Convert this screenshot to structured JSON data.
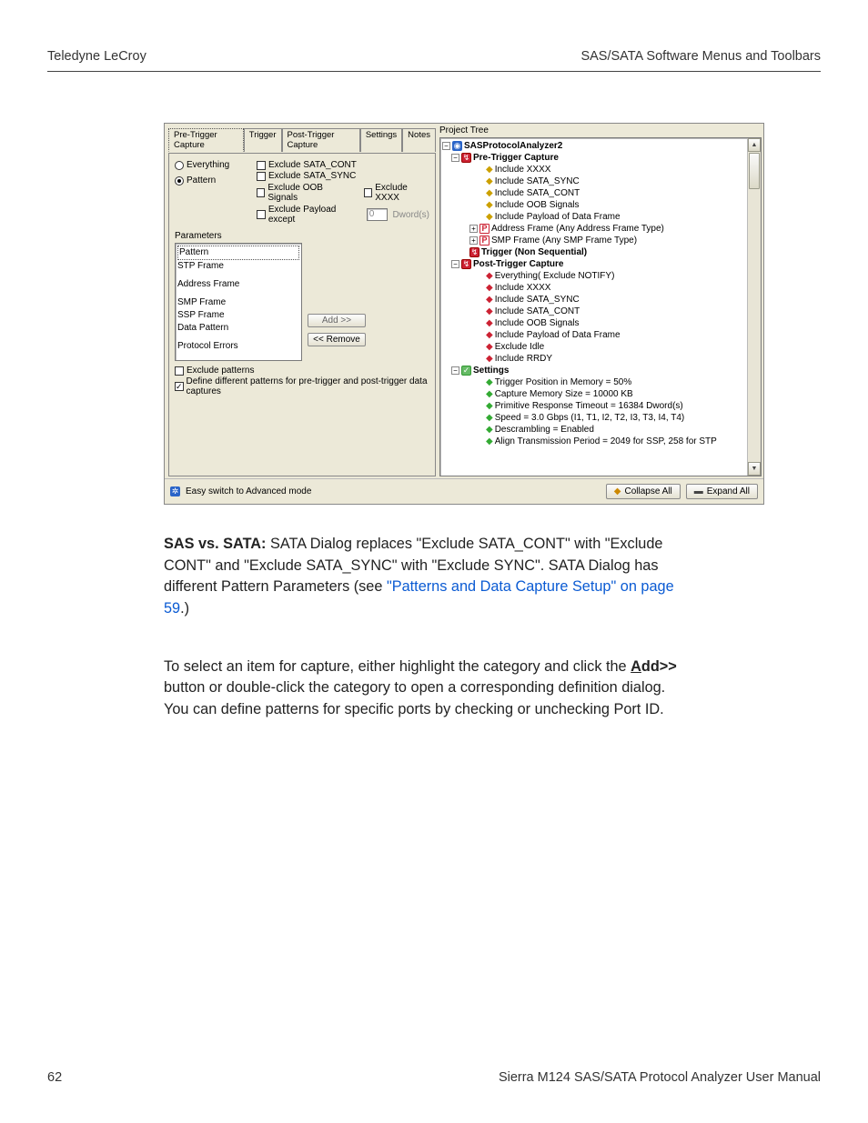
{
  "header": {
    "left": "Teledyne LeCroy",
    "right": "SAS/SATA Software Menus and Toolbars"
  },
  "footer": {
    "page": "62",
    "manual": "Sierra M124 SAS/SATA Protocol Analyzer User Manual"
  },
  "screenshot": {
    "tabs": [
      "Pre-Trigger Capture",
      "Trigger",
      "Post-Trigger Capture",
      "Settings",
      "Notes"
    ],
    "radios": {
      "everything": "Everything",
      "pattern": "Pattern"
    },
    "checks": {
      "excl_sata_cont": "Exclude SATA_CONT",
      "excl_sata_sync": "Exclude SATA_SYNC",
      "excl_oob": "Exclude OOB Signals",
      "excl_xxxx": "Exclude XXXX",
      "excl_payload": "Exclude Payload except",
      "excl_payload_val": "0",
      "excl_payload_dword": "Dword(s)"
    },
    "parameters_label": "Parameters",
    "param_items": [
      "Pattern",
      "STP Frame",
      "Address Frame",
      "SMP Frame",
      "SSP Frame",
      "Data Pattern",
      "Protocol Errors"
    ],
    "add_btn": "Add >>",
    "remove_btn": "<< Remove",
    "exclude_patterns": "Exclude patterns",
    "define_diff": "Define different patterns for pre-trigger and post-trigger data captures",
    "easy_switch": "Easy switch to Advanced mode",
    "project_tree_label": "Project Tree",
    "tree": {
      "root": "SASProtocolAnalyzer2",
      "pre": "Pre-Trigger Capture",
      "pre_items": [
        "Include XXXX",
        "Include SATA_SYNC",
        "Include SATA_CONT",
        "Include OOB Signals",
        "Include Payload of Data Frame"
      ],
      "pre_addr": "Address Frame (Any Address Frame Type)",
      "pre_smp": "SMP Frame (Any SMP Frame Type)",
      "trig": "Trigger (Non Sequential)",
      "post": "Post-Trigger Capture",
      "post_items": [
        "Everything( Exclude NOTIFY)",
        "Include XXXX",
        "Include SATA_SYNC",
        "Include SATA_CONT",
        "Include OOB Signals",
        "Include Payload of Data Frame",
        "Exclude Idle",
        "Include RRDY"
      ],
      "settings": "Settings",
      "settings_items": [
        "Trigger Position in Memory = 50%",
        "Capture Memory Size = 10000 KB",
        "Primitive Response Timeout = 16384 Dword(s)",
        "Speed = 3.0 Gbps (I1, T1, I2, T2, I3, T3, I4, T4)",
        "Descrambling = Enabled",
        "Align Transmission Period = 2049 for SSP, 258 for STP"
      ]
    },
    "collapse": "Collapse All",
    "expand": "Expand All"
  },
  "para1": {
    "lead": "SAS vs. SATA:",
    "body": " SATA Dialog replaces \"Exclude SATA_CONT\" with \"Exclude CONT\" and \"Exclude SATA_SYNC\" with \"Exclude SYNC\". SATA Dialog has different Pattern Parameters (see ",
    "link": "\"Patterns and Data Capture Setup\" on page 59",
    "tail": ".)"
  },
  "para2": {
    "a": "To select an item for capture, either highlight the category and click the ",
    "add_u": "A",
    "add_rest": "dd>>",
    "b": " button or double-click the category to open a corresponding definition dialog. You can define patterns for specific ports by checking or unchecking Port ID."
  }
}
